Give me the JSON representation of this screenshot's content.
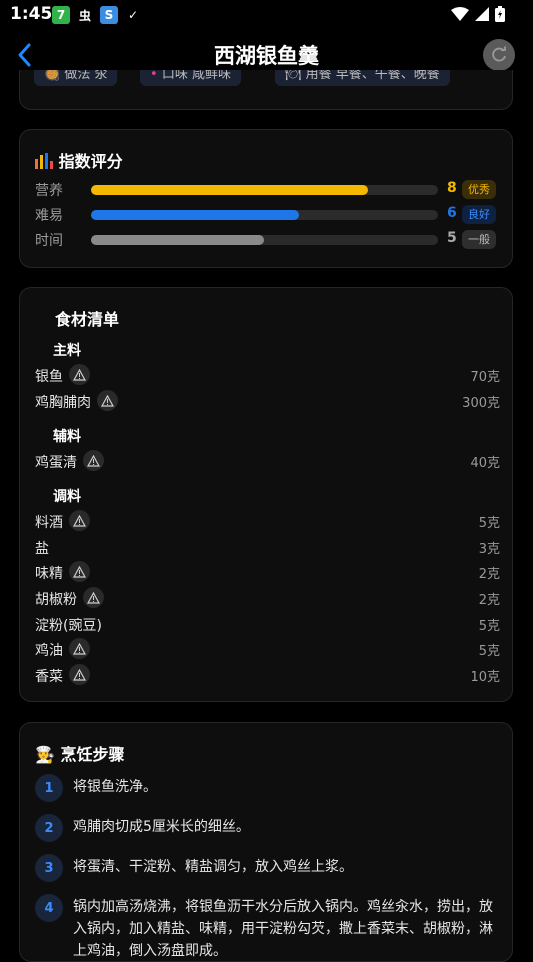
{
  "status_bar": {
    "time": "1:45",
    "app_icons": [
      {
        "glyph": "7",
        "color": "#2fb34a"
      },
      {
        "glyph": "虫",
        "color": "#000000"
      },
      {
        "glyph": "S",
        "color": "#3a8de0"
      },
      {
        "glyph": "✓",
        "color": "#000000"
      }
    ],
    "icons": [
      "wifi-icon",
      "signal-icon",
      "battery-icon"
    ]
  },
  "nav": {
    "title": "西湖银鱼羹",
    "back_icon": "chevron-left-icon",
    "refresh_icon": "refresh-icon",
    "accent": "#1e88ff"
  },
  "tags": [
    {
      "icon": "🥘",
      "label": "做法 汆"
    },
    {
      "icon": "•",
      "label": "口味 咸鲜味"
    },
    {
      "icon": "🍽",
      "label": "用餐 早餐、午餐、晚餐"
    }
  ],
  "scores": {
    "title": "指数评分",
    "items": [
      {
        "label": "营养",
        "value": "8",
        "fraction": 0.8,
        "badge": "优秀",
        "color": "#f4b800",
        "badge_bg": "#3a2e0a"
      },
      {
        "label": "难易",
        "value": "6",
        "fraction": 0.6,
        "badge": "良好",
        "color": "#1e76e8",
        "badge_bg": "#0e2240"
      },
      {
        "label": "时间",
        "value": "5",
        "fraction": 0.5,
        "badge": "一般",
        "color": "#8a8a8a",
        "badge_bg": "#2e2e2e"
      }
    ]
  },
  "ingredients": {
    "title": "食材清单",
    "groups": [
      {
        "name": "主料",
        "items": [
          {
            "name": "银鱼",
            "amount": "70克",
            "warn": true
          },
          {
            "name": "鸡胸脯肉",
            "amount": "300克",
            "warn": true
          }
        ]
      },
      {
        "name": "辅料",
        "items": [
          {
            "name": "鸡蛋清",
            "amount": "40克",
            "warn": true
          }
        ]
      },
      {
        "name": "调料",
        "items": [
          {
            "name": "料酒",
            "amount": "5克",
            "warn": true
          },
          {
            "name": "盐",
            "amount": "3克",
            "warn": false
          },
          {
            "name": "味精",
            "amount": "2克",
            "warn": true
          },
          {
            "name": "胡椒粉",
            "amount": "2克",
            "warn": true
          },
          {
            "name": "淀粉(豌豆)",
            "amount": "5克",
            "warn": false
          },
          {
            "name": "鸡油",
            "amount": "5克",
            "warn": true
          },
          {
            "name": "香菜",
            "amount": "10克",
            "warn": true
          }
        ]
      }
    ]
  },
  "steps": {
    "title": "烹饪步骤",
    "items": [
      {
        "num": "1",
        "text": "将银鱼洗净。"
      },
      {
        "num": "2",
        "text": "鸡脯肉切成5厘米长的细丝。"
      },
      {
        "num": "3",
        "text": "将蛋清、干淀粉、精盐调匀，放入鸡丝上浆。"
      },
      {
        "num": "4",
        "text": "锅内加高汤烧沸，将银鱼沥干水分后放入锅内。鸡丝汆水，捞出，放入锅内，加入精盐、味精，用干淀粉勾芡，撒上香菜末、胡椒粉，淋上鸡油，倒入汤盘即成。"
      }
    ]
  }
}
